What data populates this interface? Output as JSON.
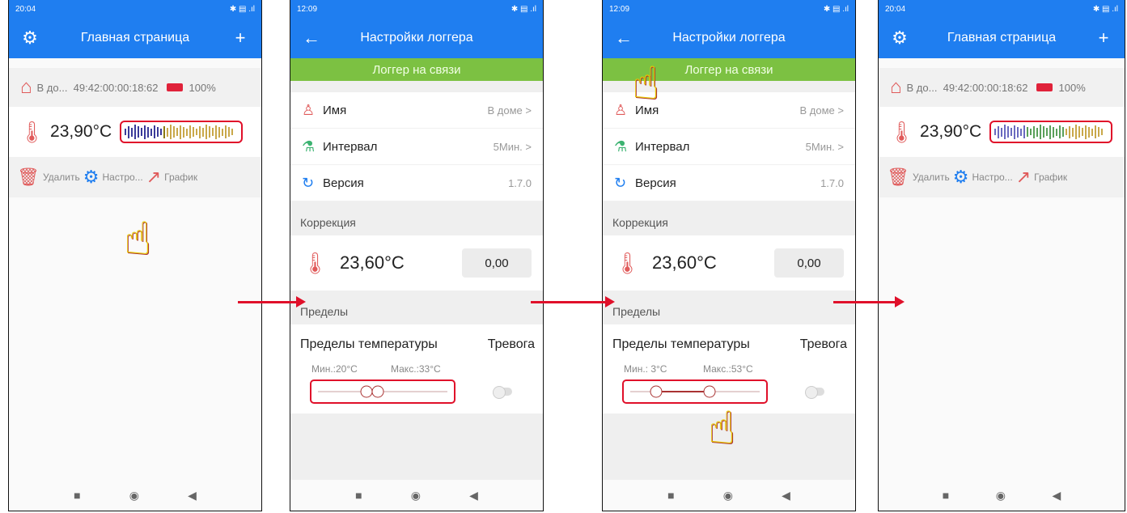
{
  "screens": [
    {
      "status_time": "20:04",
      "title": "Главная страница",
      "device_name": "В до...",
      "device_id": "49:42:00:00:18:62",
      "battery": "100%",
      "temperature": "23,90°C",
      "actions": {
        "delete": "Удалить",
        "settings": "Настро...",
        "graph": "График"
      }
    },
    {
      "status_time": "12:09",
      "title": "Настройки логгера",
      "banner": "Логгер на связи",
      "rows": [
        {
          "label": "Имя",
          "value": "В доме >"
        },
        {
          "label": "Интервал",
          "value": "5Мин. >"
        },
        {
          "label": "Версия",
          "value": "1.7.0"
        }
      ],
      "correction_header": "Коррекция",
      "correction_temp": "23,60°C",
      "correction_value": "0,00",
      "limits_header": "Пределы",
      "limits_title": "Пределы температуры",
      "alarm_label": "Тревога",
      "min_label": "Мин.:20°C",
      "max_label": "Макс.:33°C"
    },
    {
      "status_time": "12:09",
      "title": "Настройки логгера",
      "banner": "Логгер на связи",
      "rows": [
        {
          "label": "Имя",
          "value": "В доме >"
        },
        {
          "label": "Интервал",
          "value": "5Мин. >"
        },
        {
          "label": "Версия",
          "value": "1.7.0"
        }
      ],
      "correction_header": "Коррекция",
      "correction_temp": "23,60°C",
      "correction_value": "0,00",
      "limits_header": "Пределы",
      "limits_title": "Пределы температуры",
      "alarm_label": "Тревога",
      "min_label": "Мин.: 3°C",
      "max_label": "Макс.:53°C"
    },
    {
      "status_time": "20:04",
      "title": "Главная страница",
      "device_name": "В до...",
      "device_id": "49:42:00:00:18:62",
      "battery": "100%",
      "temperature": "23,90°C",
      "actions": {
        "delete": "Удалить",
        "settings": "Настро...",
        "graph": "График"
      }
    }
  ],
  "nav": {
    "recent": "■",
    "home": "◉",
    "back": "◀"
  },
  "colors": {
    "accent": "#1f7ef0",
    "banner": "#7cc142",
    "highlight": "#e0102a",
    "hand": "#e8c800"
  }
}
